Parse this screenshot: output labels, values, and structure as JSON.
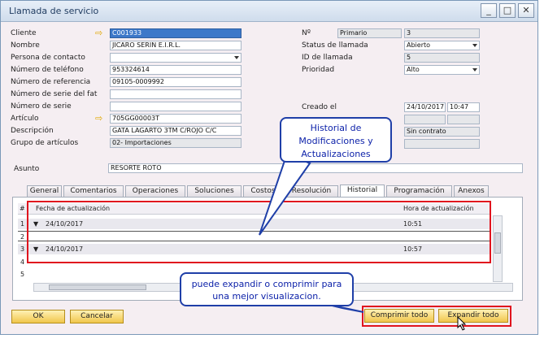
{
  "window": {
    "title": "Llamada de servicio",
    "controls": {
      "minimize": "_",
      "maximize": "□",
      "close": "✕"
    }
  },
  "left_fields": [
    {
      "label": "Cliente",
      "value": "C001933",
      "type": "link-selected"
    },
    {
      "label": "Nombre",
      "value": "JICARO SERIN E.I.R.L.",
      "type": "text"
    },
    {
      "label": "Persona de contacto",
      "value": "",
      "type": "dropdown"
    },
    {
      "label": "Número de teléfono",
      "value": "953324614",
      "type": "text"
    },
    {
      "label": "Número de referencia",
      "value": "09105-0009992",
      "type": "text"
    },
    {
      "label": "Número de serie del fat",
      "value": "",
      "type": "text"
    },
    {
      "label": "Número de serie",
      "value": "",
      "type": "text"
    },
    {
      "label": "Artículo",
      "value": "705GG00003T",
      "type": "link"
    },
    {
      "label": "Descripción",
      "value": "GATA LAGARTO 3TM C/ROJO  C/C",
      "type": "text"
    },
    {
      "label": "Grupo de artículos",
      "value": "02- Importaciones",
      "type": "readonly"
    }
  ],
  "right_fields": {
    "numero": {
      "label": "Nº",
      "series": "Primario",
      "value": "3"
    },
    "status": {
      "label": "Status de llamada",
      "value": "Abierto"
    },
    "id": {
      "label": "ID de llamada",
      "value": "5"
    },
    "priority": {
      "label": "Prioridad",
      "value": "Alto"
    },
    "created": {
      "label": "Creado el",
      "date": "24/10/2017",
      "time": "10:47"
    },
    "contract": "Sin contrato"
  },
  "subject": {
    "label": "Asunto",
    "value": "RESORTE ROTO"
  },
  "tabs": [
    {
      "label": "General",
      "active": false
    },
    {
      "label": "Comentarios",
      "active": false
    },
    {
      "label": "Operaciones",
      "active": false
    },
    {
      "label": "Soluciones",
      "active": false
    },
    {
      "label": "Costos",
      "active": false
    },
    {
      "label": "Resolución",
      "active": false
    },
    {
      "label": "Historial",
      "active": true
    },
    {
      "label": "Programación",
      "active": false
    },
    {
      "label": "Anexos",
      "active": false
    }
  ],
  "grid": {
    "columns": {
      "num": "#",
      "date": "Fecha de actualización",
      "time": "Hora de actualización"
    },
    "rows": [
      {
        "num": "1",
        "date": "24/10/2017",
        "time": "10:51"
      },
      {
        "num": "2",
        "date": "",
        "time": ""
      },
      {
        "num": "3",
        "date": "24/10/2017",
        "time": "10:57"
      },
      {
        "num": "4",
        "date": "",
        "time": ""
      },
      {
        "num": "5",
        "date": "",
        "time": ""
      }
    ]
  },
  "buttons": {
    "ok": "OK",
    "cancel": "Cancelar",
    "collapse_all": "Comprimir todo",
    "expand_all": "Expandir todo"
  },
  "callouts": {
    "history": "Historial de Modificaciones y Actualizaciones",
    "expand": "puede expandir o comprimir para una mejor visualizacion."
  },
  "colors": {
    "selected": "#3d78c9",
    "button": "#f1c64b",
    "callout_border": "#1f3fa8",
    "highlight_red": "#e0141e"
  }
}
